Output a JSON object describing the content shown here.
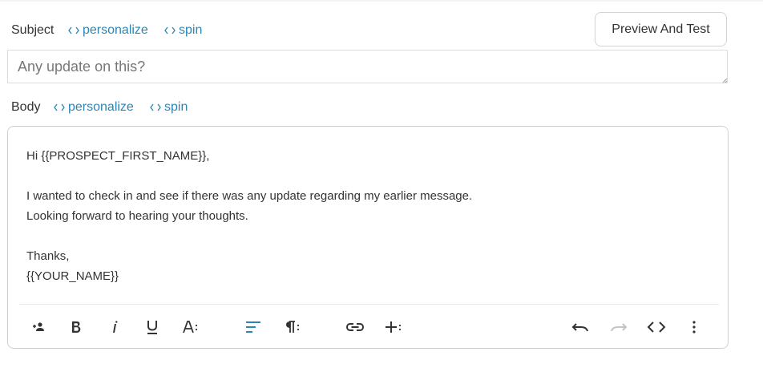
{
  "subject": {
    "label": "Subject",
    "personalize_label": "personalize",
    "spin_label": "spin",
    "value": "",
    "placeholder": "Any update on this?"
  },
  "preview_button": {
    "label": "Preview And Test"
  },
  "body": {
    "label": "Body",
    "personalize_label": "personalize",
    "spin_label": "spin",
    "lines": [
      "Hi {{PROSPECT_FIRST_NAME}},",
      "",
      "I wanted to check in and see if there was any update regarding my earlier message.",
      "Looking forward to hearing your thoughts.",
      "",
      "Thanks,",
      "{{YOUR_NAME}}"
    ]
  },
  "toolbar": {
    "items": [
      {
        "icon": "person-add-icon"
      },
      {
        "icon": "bold-icon"
      },
      {
        "icon": "italic-icon"
      },
      {
        "icon": "underline-icon"
      },
      {
        "icon": "font-size-icon"
      },
      {
        "icon": "align-left-icon"
      },
      {
        "icon": "paragraph-icon"
      },
      {
        "icon": "link-icon"
      },
      {
        "icon": "insert-more-icon"
      },
      {
        "icon": "undo-icon"
      },
      {
        "icon": "redo-icon"
      },
      {
        "icon": "code-view-icon"
      },
      {
        "icon": "more-vertical-icon"
      }
    ]
  },
  "colors": {
    "link": "#2b86b5",
    "text": "#333333",
    "active_icon": "#2b86b5",
    "disabled_icon": "#c4c4c4"
  }
}
